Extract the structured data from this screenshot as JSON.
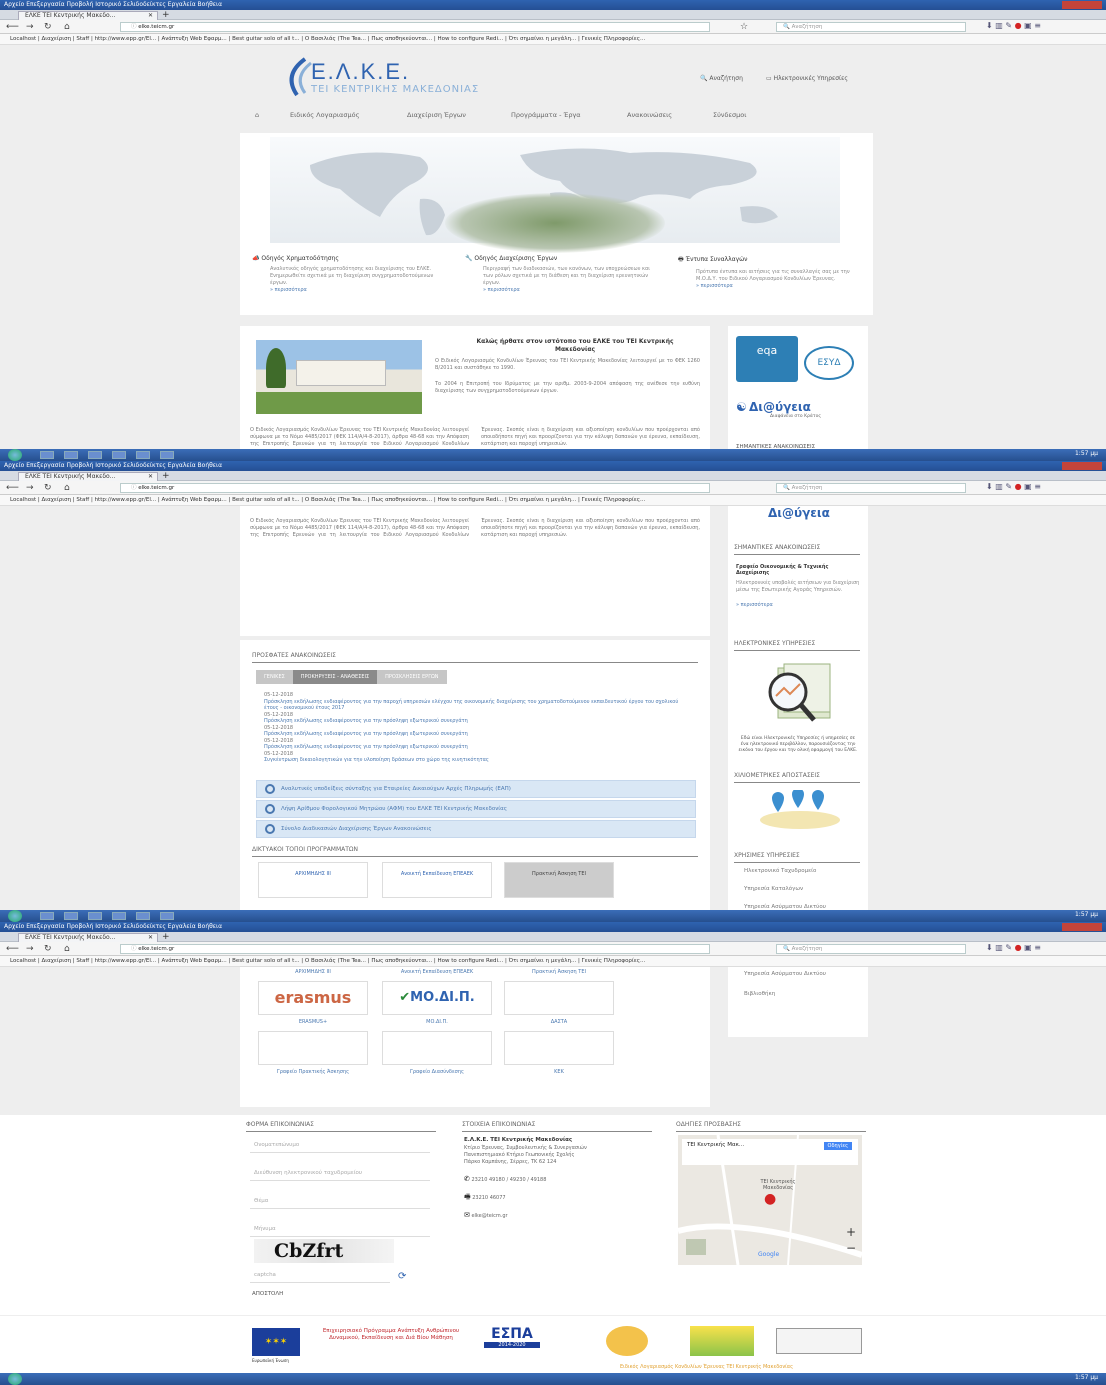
{
  "browser": {
    "tab_title": "ΕΛΚΕ ΤΕΙ Κεντρικής Μακεδο...",
    "url": "elke.teicm.gr",
    "search_placeholder": "Αναζήτηση",
    "menu_bar": "Αρχείο  Επεξεργασία  Προβολή  Ιστορικό  Σελιδοδείκτες  Εργαλεία  Βοήθεια",
    "bookmarks": "Localhost  |  Διαχείριση  |  Staff  |  http://www.epp.gr/El...  |  Ανάπτυξη Web Εφαρμ...  |  Best guitar solo of all t...  |  Ο Βασιλιάς (The Tea...  |  Πως αποθηκεύονται...  |  How to configure Redi...  |  Ότι σημαίνει η μεγάλη...  |  Γενικές Πληροφορίες...",
    "clock": "1:57 μμ"
  },
  "header": {
    "logo_title": "Ε.Λ.Κ.Ε.",
    "logo_subtitle": "ΤΕΙ ΚΕΝΤΡΙΚΗΣ ΜΑΚΕΔΟΝΙΑΣ",
    "search_link": "Αναζήτηση",
    "eservices_link": "Ηλεκτρονικές Υπηρεσίες"
  },
  "nav": [
    "Ειδικός Λογαριασμός",
    "Διαχείριση Έργων",
    "Προγράμματα - Έργα",
    "Ανακοινώσεις",
    "Σύνδεσμοι"
  ],
  "features": [
    {
      "title": "Οδηγός Χρηματοδότησης",
      "text": "Αναλυτικός οδηγός χρηματοδότησης και διαχείρισης του ΕΛΚΕ. Ενημερωθείτε σχετικά με τη διαχείριση συγχρηματοδοτούμενων έργων.",
      "more": "» περισσότερα"
    },
    {
      "title": "Οδηγός Διαχείρισης Έργων",
      "text": "Περιγραφή των διαδικασιών, των κανόνων, των υποχρεώσεων και των ρόλων σχετικά με τη διάθεση και τη διαχείριση ερευνητικών έργων.",
      "more": "» περισσότερα"
    },
    {
      "title": "Έντυπα Συναλλαγών",
      "text": "Πρότυπα έντυπα και αιτήσεις για τις συναλλαγές σας με την Μ.Ο.Δ.Υ. του Ειδικού Λογαριασμού Κονδυλίων Έρευνας.",
      "more": "» περισσότερα"
    }
  ],
  "welcome": {
    "title": "Καλώς ήρθατε στον ιστότοπο του ΕΛΚΕ του ΤΕΙ Κεντρικής Μακεδονίας",
    "p1": "Ο Ειδικός Λογαριασμός Κονδυλίων Έρευνας του ΤΕΙ Κεντρικής Μακεδονίας λειτουργεί με το ΦΕΚ 1260 Β/2011 και συστάθηκε το 1990.",
    "p2": "Το 2004 η Επιτροπή του Ιδρύματος με την αριθμ. 2003-9-2004 απόφαση της ανέθεσε την ευθύνη διαχείρισης των συγχρηματοδοτούμενων έργων.",
    "p3": "Ο Ειδικός Λογαριασμός Κονδυλίων Έρευνας του ΤΕΙ Κεντρικής Μακεδονίας λειτουργεί σύμφωνα με το Νόμο 4485/2017 (ΦΕΚ 114/Α/4-8-2017), άρθρα 48-68 και την Απόφαση της Επιτροπής Ερευνών για τη λειτουργία του Ειδικού Λογαριασμού Κονδυλίων Έρευνας. Σκοπός είναι η διαχείριση και αξιοποίηση κονδυλίων που προέρχονται από οποιαδήποτε πηγή και προορίζονται για την κάλυψη δαπανών για έρευνα, εκπαίδευση, κατάρτιση και παροχή υπηρεσιών."
  },
  "sidebar": {
    "diavgeia": "Δι@ύγεια",
    "diavgeia_sub": "Διαφάνεια στο Κράτος",
    "important_title": "ΣΗΜΑΝΤΙΚΕΣ ΑΝΑΚΟΙΝΩΣΕΙΣ",
    "important_item_title": "Γραφείο Οικονομικής & Τεχνικής Διαχείρισης",
    "important_item_text": "Ηλεκτρονικές υποβολές αιτήσεων για διαχείριση μέσω της Εσωτερικής Αγοράς Υπηρεσιών.",
    "important_more": "» περισσότερα",
    "eservices_title": "ΗΛΕΚΤΡΟΝΙΚΕΣ ΥΠΗΡΕΣΙΕΣ",
    "eservices_caption": "Εδώ είναι Ηλεκτρονικές Υπηρεσίες ή υπηρεσίες σε ένα ηλεκτρονικό περιβάλλον, παρουσιάζοντας την εικόνα του έργου και την ολική εφαρμογή του ΕΛΚΕ.",
    "distances_title": "ΧΙΛΙΟΜΕΤΡΙΚΕΣ ΑΠΟΣΤΑΣΕΙΣ",
    "useful_title": "ΧΡΗΣΙΜΕΣ ΥΠΗΡΕΣΙΕΣ",
    "useful_links": [
      "Ηλεκτρονικό Ταχυδρομείο",
      "Υπηρεσία Καταλόγων",
      "Υπηρεσία Ασύρματου Δικτύου",
      "Υπηρεσία Ασύρματου Δικτύου",
      "Βιβλιοθήκη"
    ]
  },
  "news": {
    "title": "ΠΡΟΣΦΑΤΕΣ ΑΝΑΚΟΙΝΩΣΕΙΣ",
    "tabs": [
      "ΓΕΝΙΚΕΣ",
      "ΠΡΟΚΗΡΥΞΕΙΣ - ΑΝΑΘΕΣΕΙΣ",
      "ΠΡΟΣΚΛΗΣΕΙΣ ΕΡΓΩΝ"
    ],
    "items": [
      {
        "date": "05-12-2018",
        "text": "Πρόσκληση εκδήλωσης ενδιαφέροντος για την παροχή υπηρεσιών ελέγχου της οικονομικής διαχείρισης του χρηματοδοτούμενου εκπαιδευτικού έργου του σχολικού έτους - οικονομικού έτους 2017"
      },
      {
        "date": "05-12-2018",
        "text": "Πρόσκληση εκδήλωσης ενδιαφέροντος για την πρόσληψη εξωτερικού συνεργάτη"
      },
      {
        "date": "05-12-2018",
        "text": "Πρόσκληση εκδήλωσης ενδιαφέροντος για την πρόσληψη εξωτερικού συνεργάτη"
      },
      {
        "date": "05-12-2018",
        "text": "Πρόσκληση εκδήλωσης ενδιαφέροντος για την πρόσληψη εξωτερικού συνεργάτη"
      },
      {
        "date": "05-12-2018",
        "text": "Συγκέντρωση δικαιολογητικών για την υλοποίηση δράσεων στο χώρο της κινητικότητας"
      }
    ],
    "bars": [
      "Αναλυτικές υποδείξεις σύνταξης για Εταιρείες Δικαιούχων Αρχές Πληρωμής (ΕΑΠ)",
      "Λήψη Αρίθμου Φορολογικού Μητρώου (ΑΦΜ) του ΕΛΚΕ ΤΕΙ Κεντρικής Μακεδονίας",
      "Σύνολο Διαδικασιών Διαχείρισης Έργων Ανακοινώσεις"
    ]
  },
  "programs": {
    "title": "ΔΙΚΤΥΑΚΟΙ ΤΟΠΟΙ ΠΡΟΓΡΑΜΜΑΤΩΝ",
    "items": [
      "ΑΡΧΙΜΗΔΗΣ ΙΙΙ",
      "Ανοικτή Εκπαίδευση ΕΠΕΑΕΚ",
      "Πρακτική Άσκηση ΤΕΙ",
      "ERASMUS+",
      "ΜΟ.ΔΙ.Π.",
      "ΔΑΣΤΑ",
      "Γραφείο Πρακτικής Άσκησης",
      "Γραφείο Διασύνδεσης",
      "ΚΕΚ"
    ],
    "erasmus": "erasmus",
    "modip": "ΜΟ.ΔΙ.Π."
  },
  "footer": {
    "form_title": "ΦΟΡΜΑ ΕΠΙΚΟΙΝΩΝΙΑΣ",
    "form_fields": [
      "Ονοματεπώνυμο",
      "Διεύθυνση ηλεκτρονικού ταχυδρομείου",
      "Θέμα",
      "Μήνυμα"
    ],
    "captcha": "CbZfrt",
    "captcha_placeholder": "captcha",
    "submit": "ΑΠΟΣΤΟΛΗ",
    "contact_title": "ΣΤΟΙΧΕΙΑ ΕΠΙΚΟΙΝΩΝΙΑΣ",
    "contact_org": "Ε.Λ.Κ.Ε. ΤΕΙ Κεντρικής Μακεδονίας",
    "contact_addr1": "Κτίριο Έρευνας, Συμβουλευτικής & Συνεργασιών",
    "contact_addr2": "Πανεπιστημιακό Κτήριο Γεωπονικής Σχολής",
    "contact_addr3": "Πάρκο Καμπάνης, Σέρρες, ΤΚ 62 124",
    "phone": "23210 49180 / 49230 / 49188",
    "fax": "23210 46077",
    "email": "elke@teicm.gr",
    "map_title": "ΟΔΗΓΙΕΣ ΠΡΟΣΒΑΣΗΣ",
    "map_place": "ΤΕΙ Κεντρικής Μακ...",
    "map_directions": "Οδηγίες",
    "map_label": "ΤΕΙ Κεντρικής Μακεδονίας",
    "map_google": "Google",
    "sponsor_1": "Επιχειρησιακό Πρόγραμμα Ανάπτυξη Ανθρώπινου Δυναμικού, Εκπαίδευση και Διά Βίου Μάθηση",
    "sponsor_espa": "ΕΣΠΑ",
    "sponsor_espa_years": "2014-2020",
    "sponsor_eu": "Ευρωπαϊκή Ένωση",
    "footer_note": "Ειδικός Λογαριασμός Κονδυλίων Έρευνας ΤΕΙ Κεντρικής Μακεδονίας"
  },
  "colors": {
    "brand_blue": "#2f63b0",
    "link": "#4a78b0",
    "accent_red": "#d32323",
    "page_bg": "#eeeeee"
  }
}
